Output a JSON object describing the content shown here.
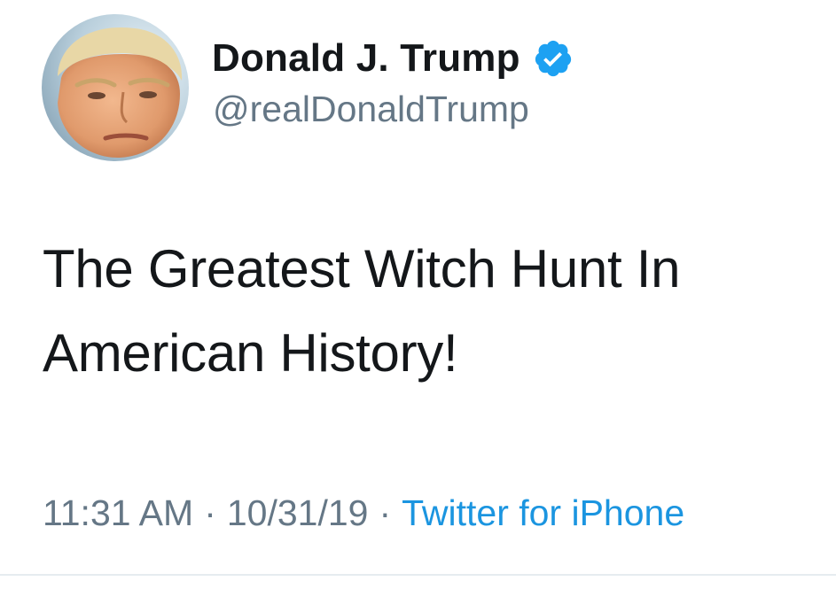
{
  "tweet": {
    "author": {
      "name": "Donald J. Trump",
      "handle": "@realDonaldTrump",
      "verified": true,
      "avatar_icon": "profile-photo"
    },
    "text": "The Greatest Witch Hunt In\nAmerican History!",
    "meta": {
      "time": "11:31 AM",
      "date": "10/31/19",
      "separator": "·",
      "source": "Twitter for iPhone"
    }
  },
  "colors": {
    "text_primary": "#14171a",
    "text_secondary": "#657786",
    "link": "#1b95e0",
    "verified_badge": "#1da1f2",
    "divider": "#e6ecf0",
    "background": "#ffffff"
  }
}
